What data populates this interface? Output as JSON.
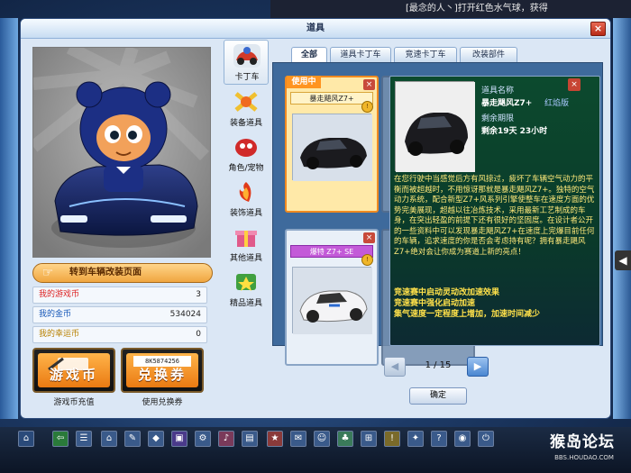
{
  "top_banner": "[最念的人丶]打开红色水气球，获得",
  "window": {
    "title": "道具",
    "close": "×"
  },
  "preview": {
    "button_label": "转到车辆改装页面"
  },
  "stats": [
    {
      "label": "我的游戏币",
      "value": "3"
    },
    {
      "label": "我的金币",
      "value": "534024"
    },
    {
      "label": "我的幸运币",
      "value": "0"
    }
  ],
  "big_buttons": {
    "game_coin": {
      "label": "游戏币",
      "caption": "游戏币充值"
    },
    "exchange": {
      "label": "兑换券",
      "caption": "使用兑换券",
      "code": "8K5874256"
    }
  },
  "categories": [
    {
      "label": "卡丁车",
      "icon": "kart-icon"
    },
    {
      "label": "装备道具",
      "icon": "equipment-icon"
    },
    {
      "label": "角色/宠物",
      "icon": "character-icon"
    },
    {
      "label": "装饰道具",
      "icon": "decoration-icon"
    },
    {
      "label": "其他道具",
      "icon": "gift-icon"
    },
    {
      "label": "精品道具",
      "icon": "premium-icon"
    }
  ],
  "tabs": [
    "全部",
    "道具卡丁车",
    "竞速卡丁车",
    "改装部件"
  ],
  "items": [
    {
      "name": "暴走飓风Z7+",
      "tag": "使用中",
      "close": "×",
      "coin": "!"
    },
    {
      "name": "爆特 Z7+ SE",
      "close": "×",
      "coin": "!"
    }
  ],
  "detail": {
    "close": "×",
    "name_label": "道具名称",
    "name_value": "暴走飓风Z7+",
    "color_label": "红焰版",
    "time_label": "剩余期限",
    "time_value": "剩余19天  23小时",
    "description": "在您行驶中当感觉后方有风掠过，疲坏了车辆空气动力的平衡而被超越时，不用惊讶那就是暴走飓风Z7+。独特的空气动力系统，配合新型Z7+风系列引擎使整车在速度方面的优势完美展现，超越以往冶炼技术，采用最新工艺制成的车身，在突出轻盈的前提下还有很好的坚固度。在设计者公开的一些资料中可以发现暴走飓风Z7+在速度上完爆目前任何的车辆，追求速度的你是否会考虑持有呢？拥有暴走飓风Z7+绝对会让你成为赛道上新的亮点！",
    "skills": [
      "竞速赛中启动灵动改加速效果",
      "竞速赛中强化启动加速",
      "集气速度一定程度上增加，加速时间减少"
    ]
  },
  "pager": {
    "prev": "◀",
    "next": "▶",
    "text": "1 / 15"
  },
  "confirm_label": "确定",
  "side_arrow": "◀",
  "logo": {
    "text": "猴岛论坛",
    "sub": "BBS.HOUDAO.COM"
  },
  "colors": {
    "accent": "#f08a20",
    "window_bg": "#dbe7f5",
    "detail_bg": "#0c4a2e",
    "desc_text": "#ffe97a"
  }
}
